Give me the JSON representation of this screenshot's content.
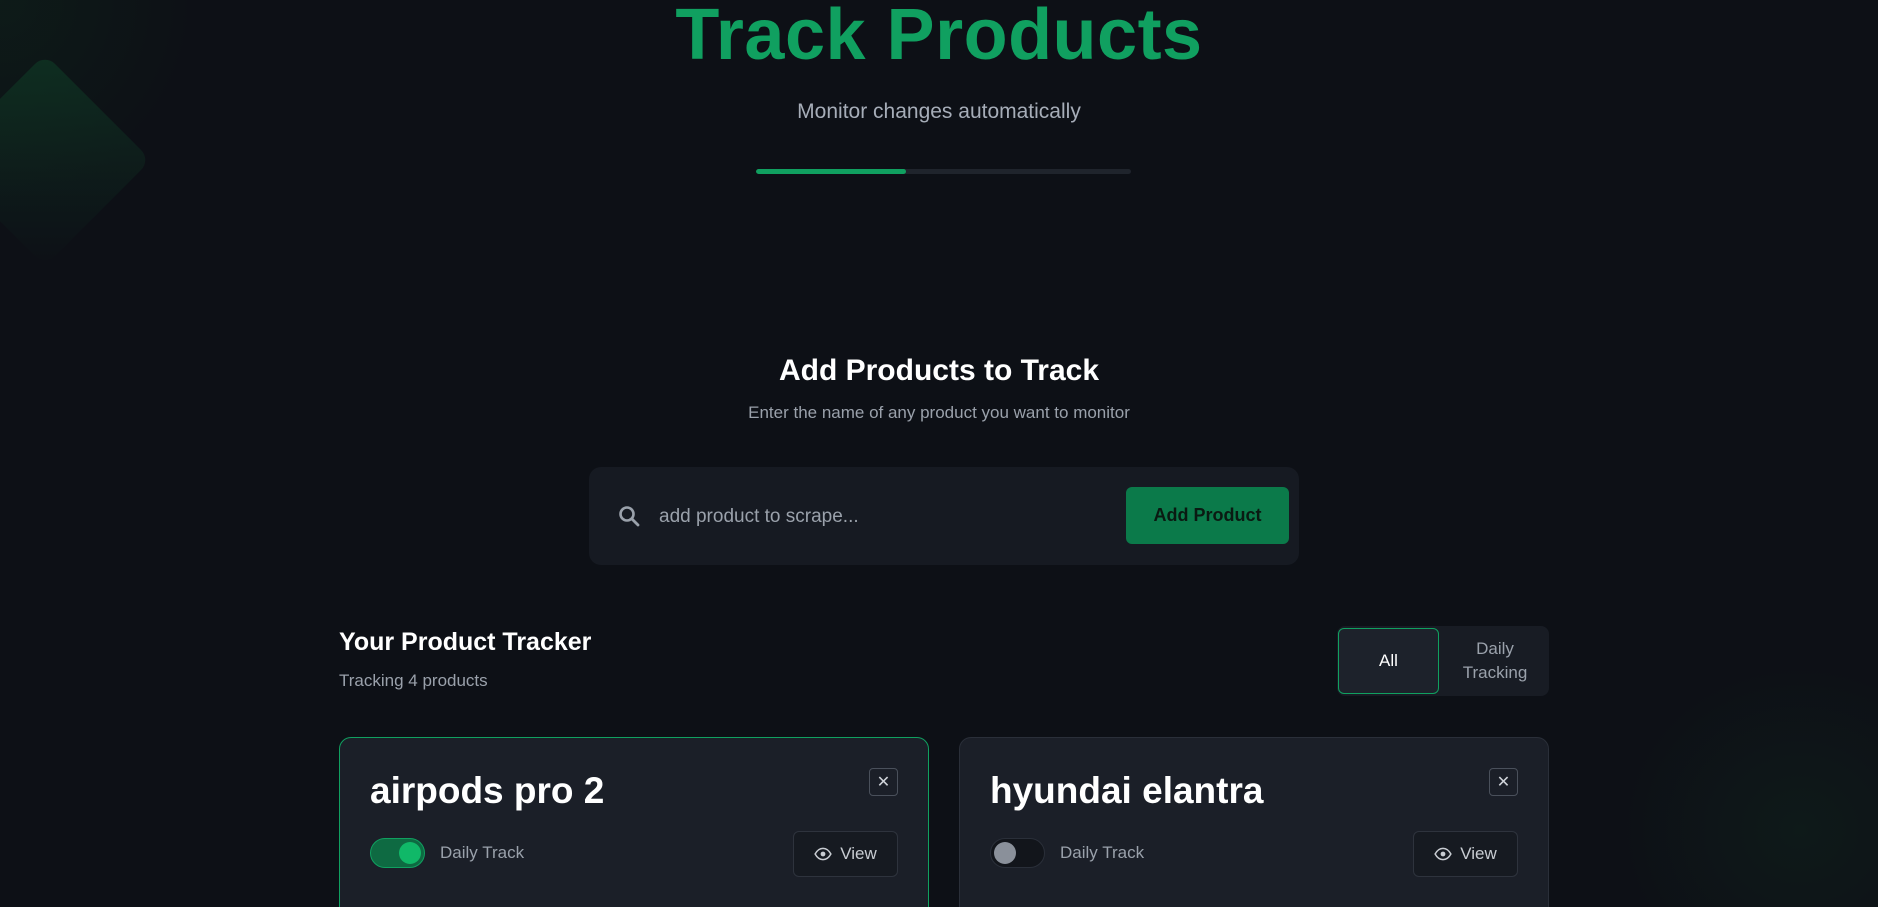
{
  "hero": {
    "title": "Track Products",
    "subtitle": "Monitor changes automatically",
    "progress_fraction": 0.4,
    "accent_color": "#10a060"
  },
  "add_section": {
    "title": "Add Products to Track",
    "subtitle": "Enter the name of any product you want to monitor",
    "search_placeholder": "add product to scrape...",
    "search_value": "",
    "search_icon": "search-icon",
    "add_button_label": "Add Product"
  },
  "tracker": {
    "title": "Your Product Tracker",
    "count_text": "Tracking 4 products",
    "filters": {
      "all_label": "All",
      "daily_label": "Daily Tracking",
      "selected": "All"
    }
  },
  "products": [
    {
      "name": "airpods pro 2",
      "daily_track_on": true,
      "toggle_label": "Daily Track",
      "view_label": "View",
      "close_label": "✕"
    },
    {
      "name": "hyundai elantra",
      "daily_track_on": false,
      "toggle_label": "Daily Track",
      "view_label": "View",
      "close_label": "✕"
    }
  ]
}
